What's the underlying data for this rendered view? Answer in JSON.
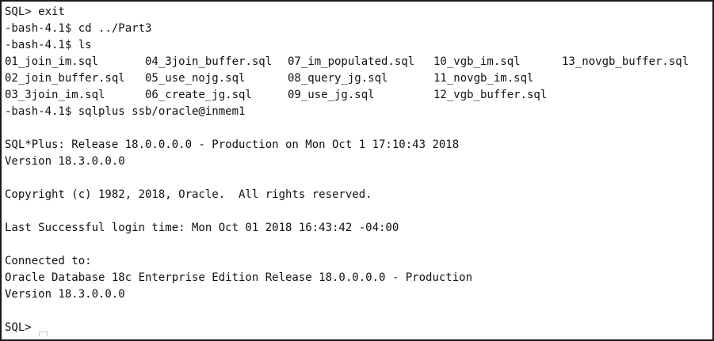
{
  "terminal": {
    "lines_top": [
      "SQL> exit",
      "-bash-4.1$ cd ../Part3",
      "-bash-4.1$ ls"
    ],
    "ls_rows": [
      [
        "01_join_im.sql",
        "04_3join_buffer.sql",
        "07_im_populated.sql",
        "10_vgb_im.sql",
        "13_novgb_buffer.sql"
      ],
      [
        "02_join_buffer.sql",
        "05_use_nojg.sql",
        "08_query_jg.sql",
        "11_novgb_im.sql",
        ""
      ],
      [
        "03_3join_im.sql",
        "06_create_jg.sql",
        "09_use_jg.sql",
        "12_vgb_buffer.sql",
        ""
      ]
    ],
    "lines_bottom": [
      "-bash-4.1$ sqlplus ssb/oracle@inmem1",
      "",
      "SQL*Plus: Release 18.0.0.0.0 - Production on Mon Oct 1 17:10:43 2018",
      "Version 18.3.0.0.0",
      "",
      "Copyright (c) 1982, 2018, Oracle.  All rights reserved.",
      "",
      "Last Successful login time: Mon Oct 01 2018 16:43:42 -04:00",
      "",
      "Connected to:",
      "Oracle Database 18c Enterprise Edition Release 18.0.0.0.0 - Production",
      "Version 18.3.0.0.0",
      ""
    ],
    "final_prompt": "SQL>",
    "colors": {
      "background": "#ffffff",
      "text": "#111111",
      "border": "#1a1a1a"
    }
  }
}
